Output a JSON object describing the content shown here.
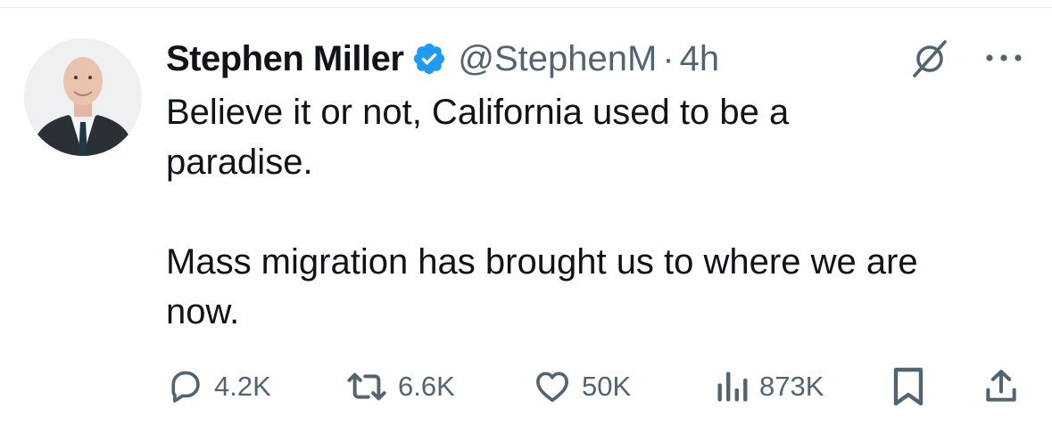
{
  "tweet": {
    "author": {
      "name": "Stephen Miller",
      "handle": "@StephenM",
      "verified": true,
      "verified_color": "#1d9bf0"
    },
    "separator": "·",
    "timestamp": "4h",
    "text_lines": [
      "Believe it or not, California used to be a",
      "paradise.",
      "Mass migration has brought us to where we are",
      "now."
    ],
    "header_icons": [
      "grok-icon",
      "more-icon"
    ]
  },
  "actions": {
    "reply": {
      "icon": "reply-icon",
      "count": "4.2K"
    },
    "retweet": {
      "icon": "retweet-icon",
      "count": "6.6K"
    },
    "like": {
      "icon": "heart-icon",
      "count": "50K"
    },
    "views": {
      "icon": "views-icon",
      "count": "873K"
    },
    "bookmark": {
      "icon": "bookmark-icon"
    },
    "share": {
      "icon": "share-icon"
    }
  },
  "colors": {
    "text_primary": "#0f1419",
    "text_secondary": "#536471",
    "accent": "#1d9bf0",
    "divider": "#e6e8ea"
  }
}
